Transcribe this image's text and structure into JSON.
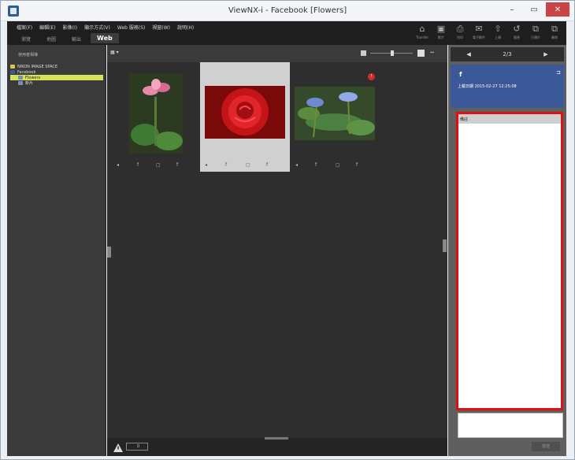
{
  "window": {
    "title": "ViewNX-i - Facebook [Flowers]",
    "controls": [
      "–",
      "▭",
      "✕"
    ]
  },
  "menu": [
    "檔案(F)",
    "編輯(E)",
    "影像(I)",
    "顯示方式(V)",
    "Web 服務(S)",
    "視窗(W)",
    "說明(H)"
  ],
  "mode_tabs": [
    "瀏覽",
    "地圖",
    "輸出",
    "Web"
  ],
  "toolbar": [
    "Transfer",
    "影片",
    "列印",
    "電子郵件",
    "上傳",
    "復原",
    "已傳片",
    "刪除"
  ],
  "left_panel": {
    "title": "使用者相簿",
    "tree": [
      {
        "label": "NIKON IMAGE SPACE",
        "icon": "nikon-icon"
      },
      {
        "label": "Facebook",
        "icon": "facebook-icon"
      },
      {
        "label": "Flowers",
        "icon": "album-icon",
        "selected": true
      },
      {
        "label": "新片",
        "icon": "album-icon"
      }
    ]
  },
  "center": {
    "view_button": "▦ ▾",
    "fit_button": "↔",
    "flag_text": "!",
    "thumb_controls": [
      "◂",
      "f",
      "▢",
      "f"
    ],
    "bottom_count": "0"
  },
  "right_panel": {
    "nav": {
      "prev": "◀",
      "page": "2/3",
      "next": "▶"
    },
    "fb_logo": "f",
    "fullscreen": "⊐",
    "upload_info": "上載日期 2015-02-27 12:25:08",
    "comment_label": "備註",
    "send_label": "發送"
  },
  "colors": {
    "facebook_blue": "#3b5998",
    "highlight_red": "#dd1111",
    "selection_yellow": "#d9e05a"
  }
}
